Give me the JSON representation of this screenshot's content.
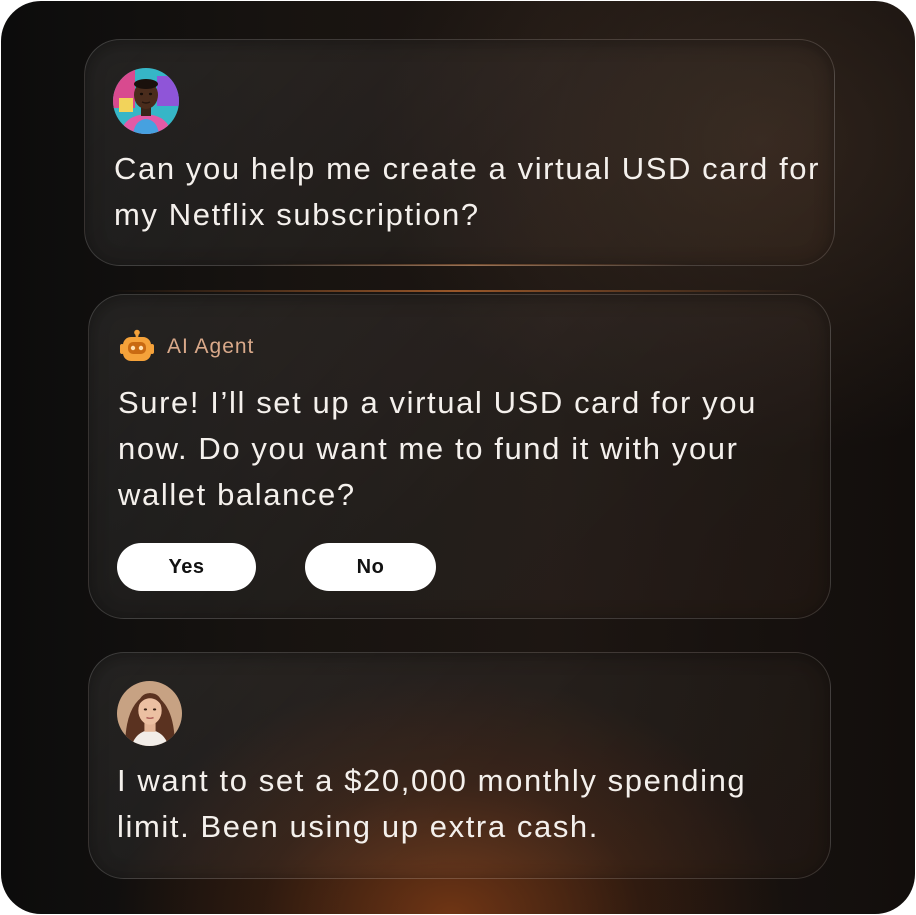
{
  "messages": [
    {
      "sender": "user",
      "avatar": "man-avatar-icon",
      "text": "Can you help me create a virtual USD card for my Netflix subscription?"
    },
    {
      "sender": "agent",
      "agent_label": "AI Agent",
      "agent_icon": "robot-icon",
      "text": "Sure! I’ll set up a virtual USD card for you now. Do you want me to fund it with your wallet balance?",
      "actions": [
        {
          "label": "Yes"
        },
        {
          "label": "No"
        }
      ]
    },
    {
      "sender": "user",
      "avatar": "woman-avatar-icon",
      "text": "I want to set a $20,000 monthly spending limit. Been using up extra cash."
    }
  ],
  "colors": {
    "accent_orange": "#f5a23a",
    "agent_label": "#d9a98a",
    "text": "#f4f0ec",
    "button_bg": "#ffffff"
  }
}
